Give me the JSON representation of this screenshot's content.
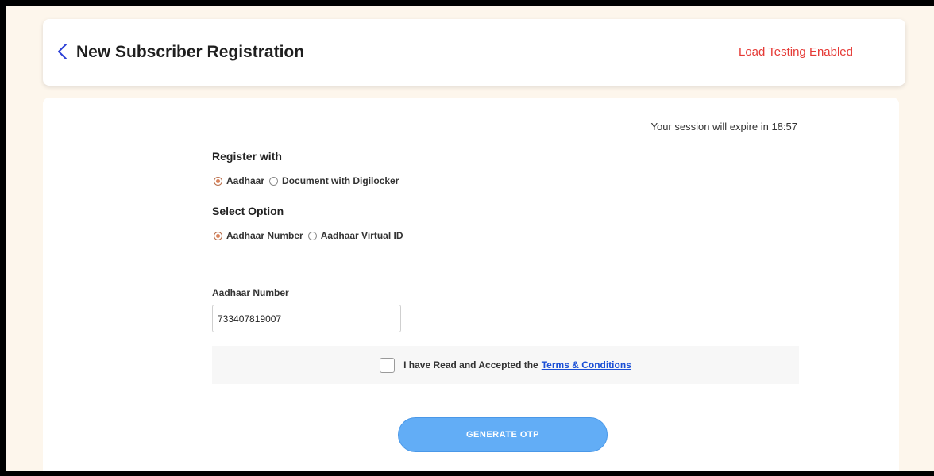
{
  "header": {
    "title": "New Subscriber Registration",
    "load_testing": "Load Testing Enabled"
  },
  "session": {
    "text": "Your session will expire in 18:57"
  },
  "register_with": {
    "label": "Register with",
    "options": [
      {
        "label": "Aadhaar",
        "checked": true
      },
      {
        "label": "Document with Digilocker",
        "checked": false
      }
    ]
  },
  "select_option": {
    "label": "Select Option",
    "options": [
      {
        "label": "Aadhaar Number",
        "checked": true
      },
      {
        "label": "Aadhaar Virtual ID",
        "checked": false
      }
    ]
  },
  "aadhaar_field": {
    "label": "Aadhaar Number",
    "value": "733407819007"
  },
  "terms": {
    "text": "I have Read and Accepted the",
    "link": "Terms & Conditions",
    "checked": false
  },
  "otp_button": {
    "label": "GENERATE OTP"
  },
  "colors": {
    "accent_blue": "#62adf6",
    "warning_red": "#e53935",
    "page_bg": "#fdf6ec",
    "radio_checked": "#d9825a",
    "link": "#1a4fd6"
  }
}
